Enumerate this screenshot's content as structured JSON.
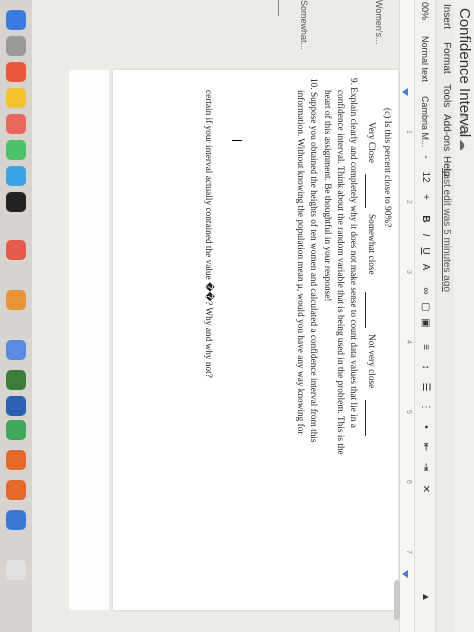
{
  "window": {
    "title": "Confidence Interval"
  },
  "menu": {
    "items": [
      "Insert",
      "Format",
      "Tools",
      "Add-ons",
      "Help"
    ],
    "last_edit": "Last edit was 5 minutes ago"
  },
  "toolbar": {
    "zoom": "00%",
    "style": "Normal text",
    "font": "Cambria M...",
    "font_size": "12",
    "minus": "-",
    "plus": "+",
    "bold": "B",
    "italic": "I",
    "underline": "U",
    "text_color": "A"
  },
  "ruler": {
    "ticks": [
      "1",
      "2",
      "3",
      "4",
      "5",
      "6",
      "7"
    ]
  },
  "outline": {
    "item1": "Women's...",
    "item2": "Somewhat..."
  },
  "doc": {
    "q_c": "(c) Is this percent close to 90%?",
    "opt_very": "Very Close",
    "opt_somewhat": "Somewhat close",
    "opt_not": "Not very close",
    "q9_line1": "9. Explain clearly and completely why it does not make sense to count data values that lie in a",
    "q9_line2": "confidence interval. Think about the random variable that is being used in the problem. This is the",
    "q9_line3": "heart of this assignment. Be thoughtful in your response!",
    "q10_line1": "10. Suppose you obtained the heights of ten women and calculated a confidence interval from this",
    "q10_line2": "information. Without knowing the population mean μ, would you have any way knowing for",
    "q10_line3": "certain if your interval actually contained the value ��? Why and why not?"
  }
}
